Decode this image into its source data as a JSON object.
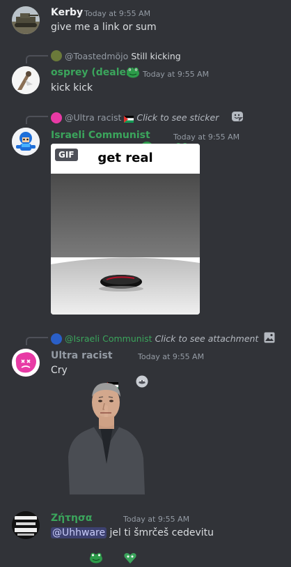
{
  "messages": [
    {
      "author": "Kerby",
      "timestamp": "Today at 9:55 AM",
      "text": "give me a link or sum",
      "name_color": "#f2f3f5"
    },
    {
      "reply": {
        "name": "@Toastedmöjo",
        "text": "Still kicking"
      },
      "author": "osprey (dealer)",
      "timestamp": "Today at 9:55 AM",
      "text": "kick kick",
      "name_color": "#3ba55c"
    },
    {
      "reply": {
        "name": "@Ultra racist",
        "text": "Click to see sticker"
      },
      "author": "Israeli Communist",
      "timestamp": "Today at 9:55 AM",
      "name_color": "#3ba55c",
      "gif": {
        "badge": "GIF",
        "caption": "get real"
      }
    },
    {
      "reply": {
        "name": "@Israeli Communist",
        "text": "Click to see attachment"
      },
      "author": "Ultra racist",
      "timestamp": "Today at 9:55 AM",
      "text": "Cry",
      "name_color": "#949ba4"
    },
    {
      "author": "Ζήτησα",
      "timestamp": "Today at 9:55 AM",
      "mention": "@Uhhware",
      "text": "jel ti šmrčeš cedevitu",
      "name_color": "#3ba55c"
    }
  ],
  "icons": {
    "sticker": "sticker-icon",
    "attachment": "image-icon",
    "role_badge": "green-frog-badge",
    "flag": "palestine-flag"
  },
  "colors": {
    "background": "#313338",
    "green_role": "#3ba55c",
    "timestamp": "#949ba4",
    "mention_bg": "#5865f2"
  }
}
